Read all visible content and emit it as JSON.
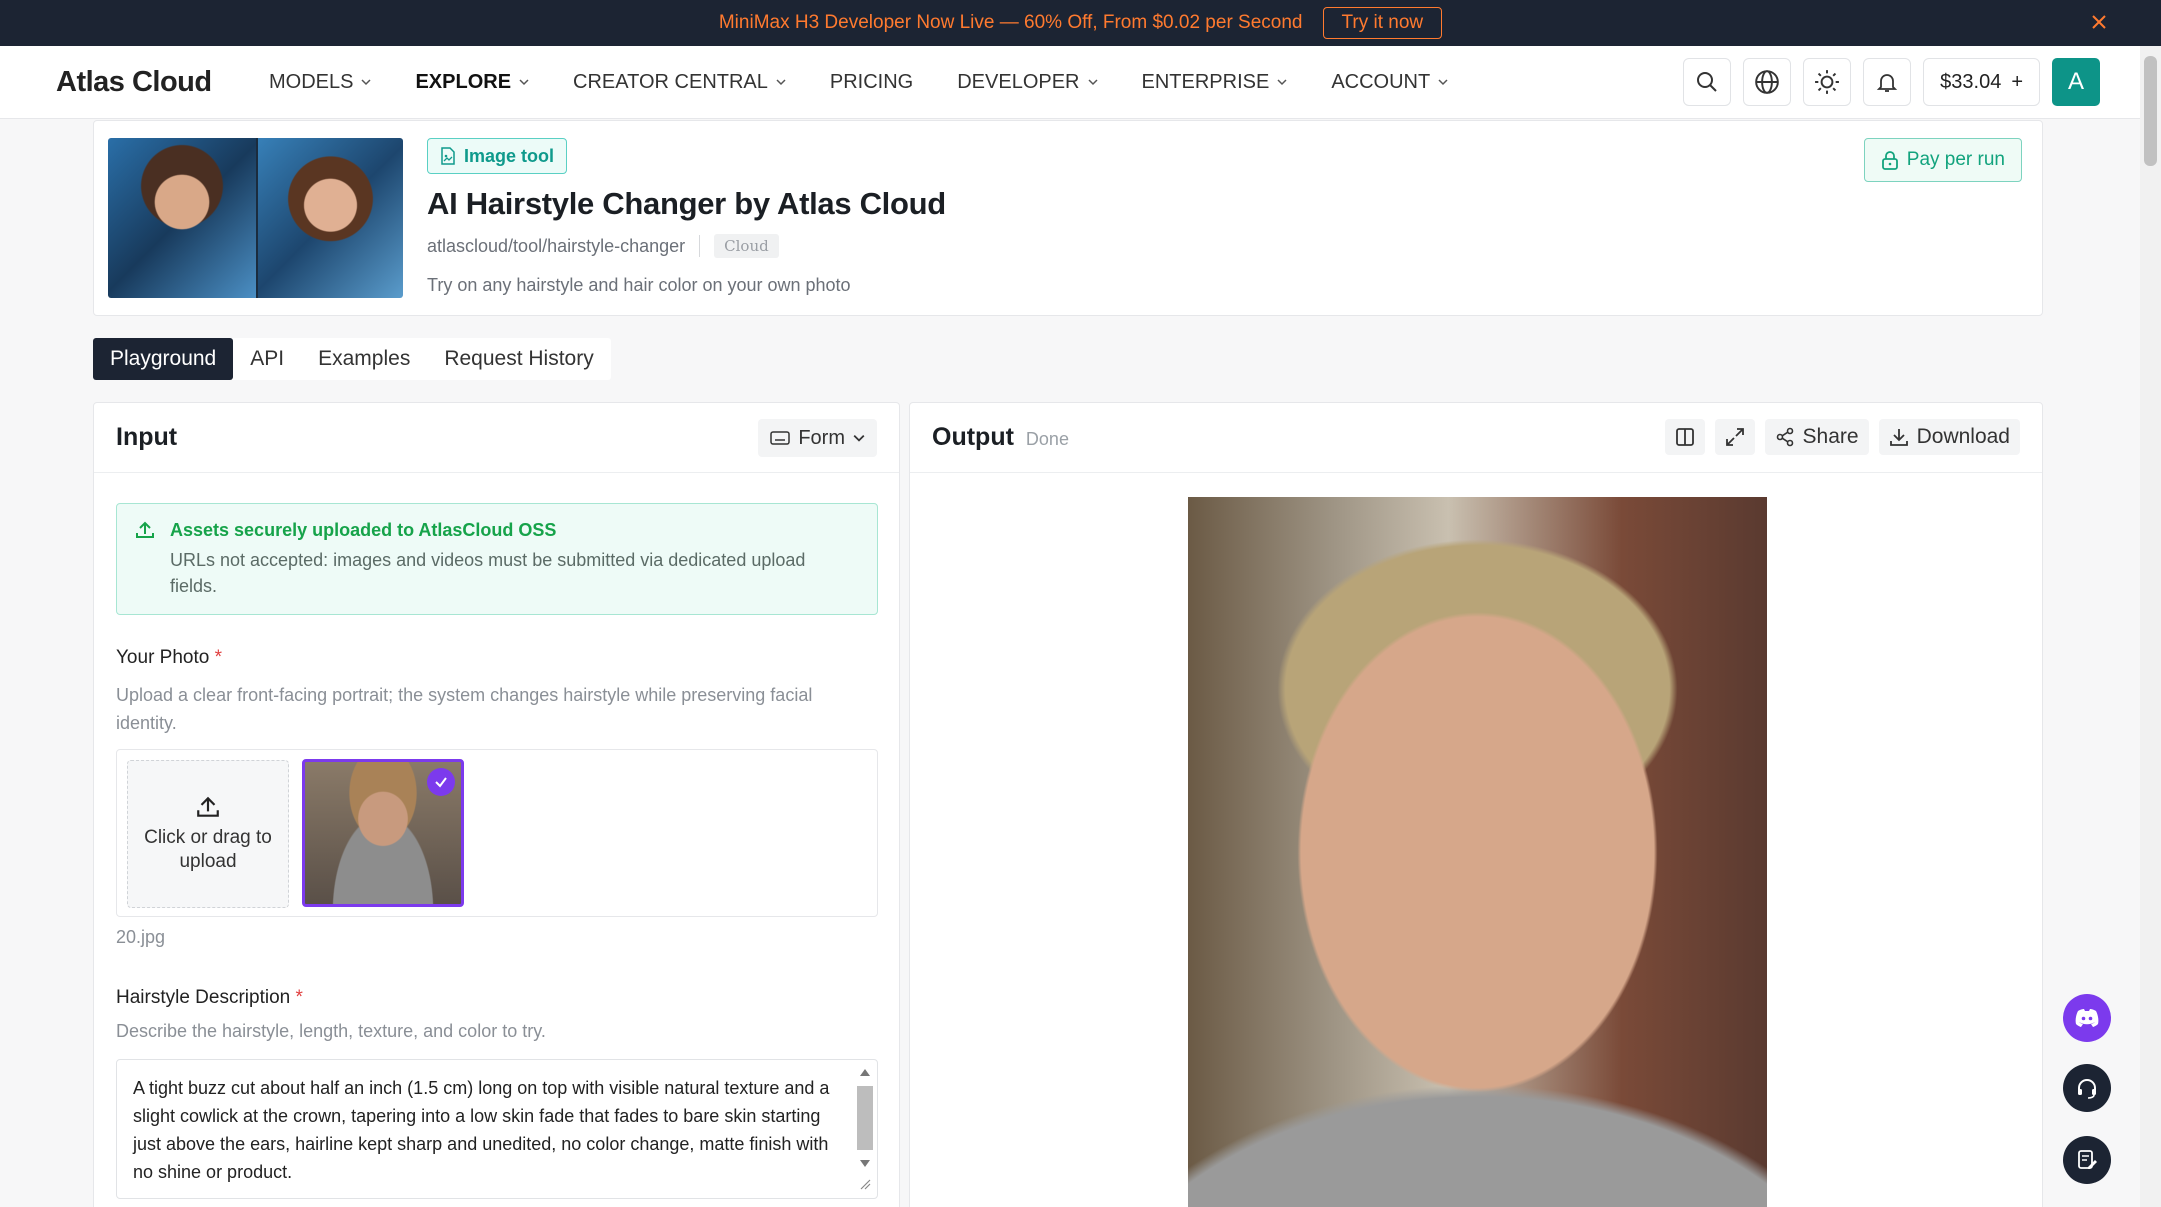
{
  "promo": {
    "text": "MiniMax H3 Developer Now Live — 60% Off, From $0.02 per Second",
    "button": "Try it now"
  },
  "nav": {
    "logo": "Atlas Cloud",
    "menu": [
      "MODELS",
      "EXPLORE",
      "CREATOR CENTRAL",
      "PRICING",
      "DEVELOPER",
      "ENTERPRISE",
      "ACCOUNT"
    ],
    "balance": "$33.04",
    "avatar_letter": "A"
  },
  "tool": {
    "badge": "Image tool",
    "title": "AI Hairstyle Changer by Atlas Cloud",
    "path": "atlascloud/tool/hairstyle-changer",
    "cloud_tag": "Cloud",
    "tagline": "Try on any hairstyle and hair color on your own photo",
    "pay_label": "Pay per run"
  },
  "tabs": [
    "Playground",
    "API",
    "Examples",
    "Request History"
  ],
  "input": {
    "title": "Input",
    "mode": "Form",
    "notice_title": "Assets securely uploaded to AtlasCloud OSS",
    "notice_body": "URLs not accepted: images and videos must be submitted via dedicated upload fields.",
    "photo_label": "Your Photo",
    "photo_help": "Upload a clear front-facing portrait; the system changes hairstyle while preserving facial identity.",
    "upload_text": "Click or drag to upload",
    "filename": "20.jpg",
    "desc_label": "Hairstyle Description",
    "desc_help": "Describe the hairstyle, length, texture, and color to try.",
    "desc_value": "A tight buzz cut about half an inch (1.5 cm) long on top with visible natural texture and a slight cowlick at the crown, tapering into a low skin fade that fades to bare skin starting just above the ears, hairline kept sharp and unedited, no color change, matte finish with no shine or product."
  },
  "output": {
    "title": "Output",
    "status": "Done",
    "share": "Share",
    "download": "Download"
  },
  "colors": {
    "accent": "#0d9488",
    "dark": "#1c2433",
    "promo": "#ff7a2f",
    "selected": "#7c3aed"
  }
}
